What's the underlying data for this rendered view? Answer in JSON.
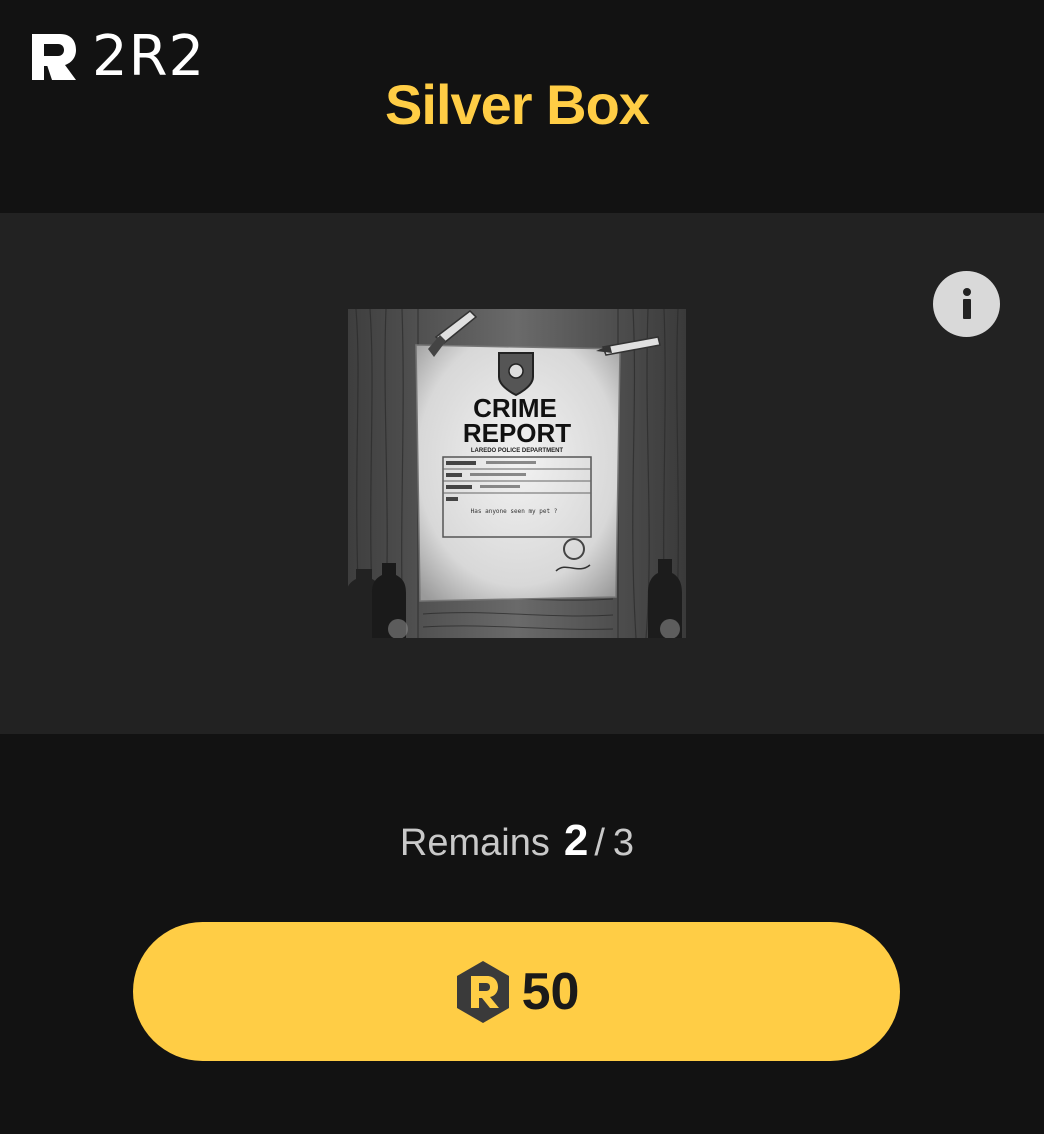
{
  "header": {
    "logo_text": "2R2",
    "title": "Silver Box"
  },
  "colors": {
    "accent": "#FFCD45",
    "background": "#121212",
    "panel": "#222222",
    "info_button": "#d9d9d9"
  },
  "card": {
    "heading_line1": "CRIME",
    "heading_line2": "REPORT",
    "subheading": "LAREDO POLICE DEPARTMENT",
    "note": "Has anyone seen my pet ?"
  },
  "info": {
    "icon": "info-icon",
    "glyph": "i"
  },
  "remains": {
    "label": "Remains",
    "current": "2",
    "separator": "/",
    "total": "3"
  },
  "buy": {
    "icon": "r-coin-icon",
    "price": "50"
  }
}
